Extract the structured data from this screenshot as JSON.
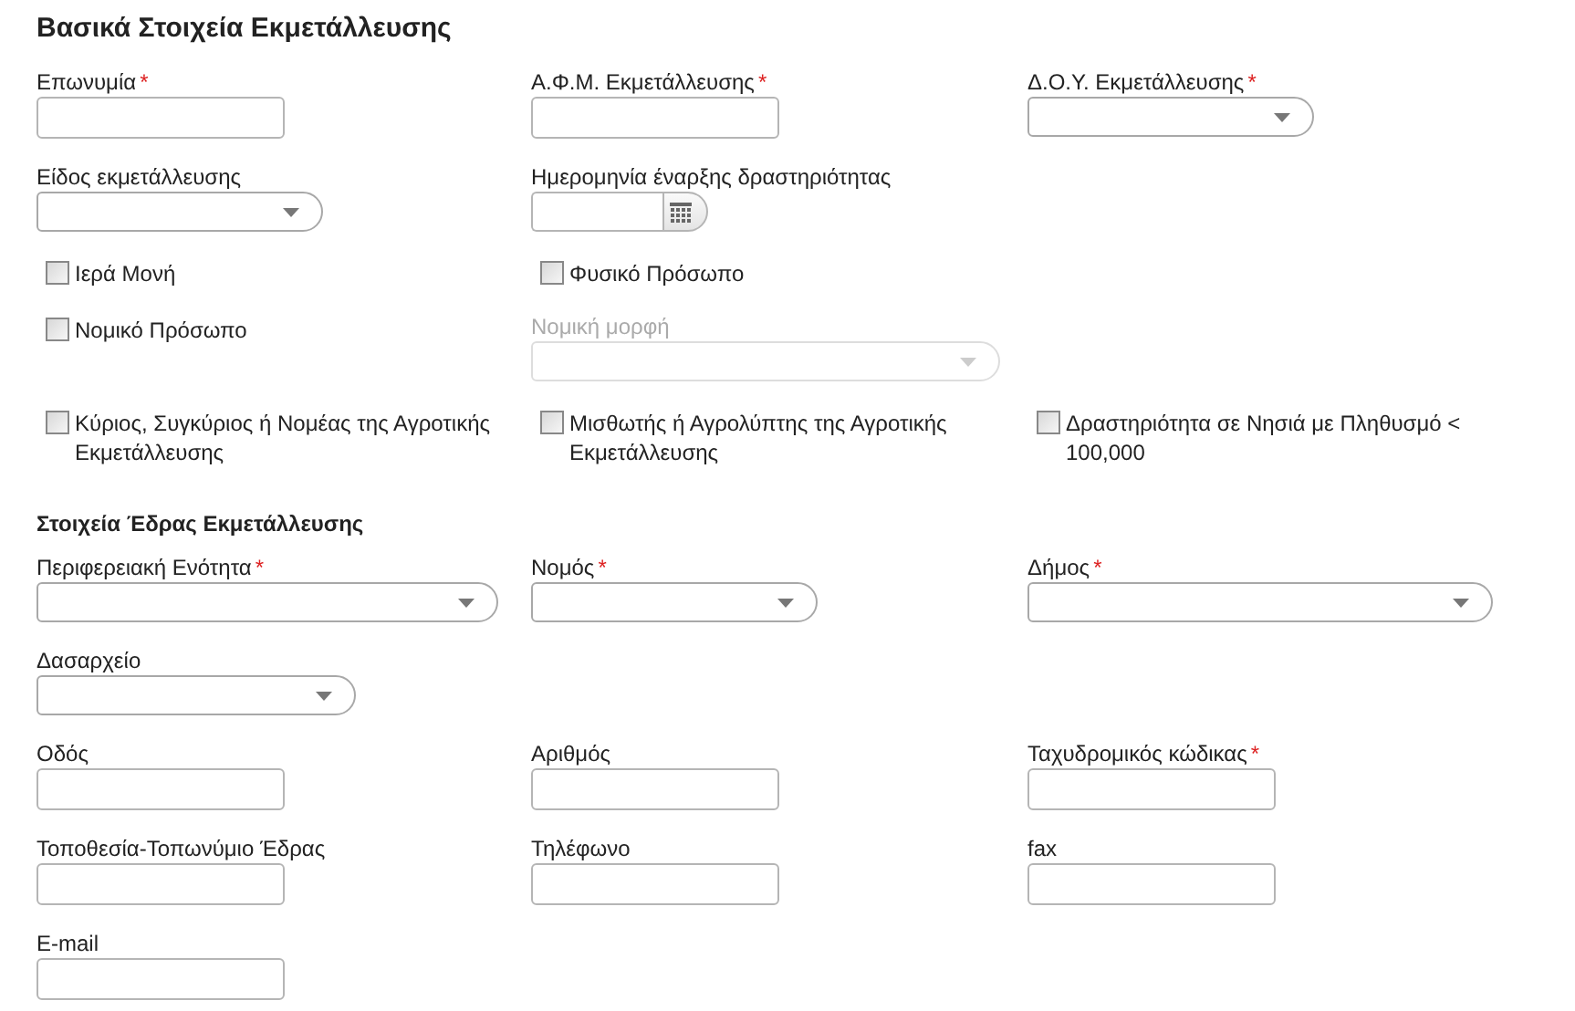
{
  "sections": [
    {
      "kind": "heading",
      "title": "Βασικά Στοιχεία Εκμετάλλευσης",
      "rows": [
        [
          {
            "kind": "input",
            "label": "Επωνυμία",
            "required_mark": "*"
          },
          {
            "kind": "input",
            "label": "Α.Φ.Μ. Εκμετάλλευσης",
            "required_mark": "*"
          },
          {
            "kind": "select",
            "label": "Δ.Ο.Υ. Εκμετάλλευσης",
            "required_mark": "*",
            "disabled": false
          }
        ],
        [
          {
            "kind": "select",
            "label": "Είδος εκμετάλλευσης",
            "disabled": false
          },
          {
            "kind": "date",
            "label": "Ημερομηνία έναρξης δραστηριότητας"
          },
          null
        ],
        [
          {
            "kind": "checkbox",
            "label": "Ιερά Μονή",
            "checked": false
          },
          {
            "kind": "checkbox",
            "label": "Φυσικό Πρόσωπο",
            "checked": false
          },
          null
        ],
        [
          {
            "kind": "checkbox",
            "label": "Νομικό Πρόσωπο",
            "checked": false
          },
          {
            "kind": "select",
            "label": "Νομική μορφή",
            "disabled": true
          },
          null
        ],
        [
          {
            "kind": "checkbox",
            "label": "Κύριος, Συγκύριος ή Νομέας της Αγροτικής Εκμετάλλευσης",
            "checked": false
          },
          {
            "kind": "checkbox",
            "label": "Μισθωτής ή Αγρολύπτης της Αγροτικής Εκμετάλλευσης",
            "checked": false
          },
          {
            "kind": "checkbox",
            "label": "Δραστηριότητα σε Νησιά με Πληθυσμό < 100,000",
            "checked": false
          }
        ]
      ]
    },
    {
      "kind": "subheading",
      "title": "Στοιχεία Έδρας Εκμετάλλευσης",
      "rows": [
        [
          {
            "kind": "select",
            "label": "Περιφερειακή Ενότητα",
            "required_mark": "*",
            "disabled": false
          },
          {
            "kind": "select",
            "label": "Νομός",
            "required_mark": "*",
            "disabled": false
          },
          {
            "kind": "select",
            "label": "Δήμος",
            "required_mark": "*",
            "disabled": false
          }
        ],
        [
          {
            "kind": "select",
            "label": "Δασαρχείο",
            "disabled": false
          },
          null,
          null
        ],
        [
          {
            "kind": "input",
            "label": "Οδός"
          },
          {
            "kind": "input",
            "label": "Αριθμός"
          },
          {
            "kind": "input",
            "label": "Ταχυδρομικός κώδικας",
            "required_mark": "*"
          }
        ],
        [
          {
            "kind": "input",
            "label": "Τοποθεσία-Τοπωνύμιο Έδρας"
          },
          {
            "kind": "input",
            "label": "Τηλέφωνο"
          },
          {
            "kind": "input",
            "label": "fax"
          }
        ],
        [
          {
            "kind": "input",
            "label": "E-mail"
          },
          null,
          null
        ]
      ]
    }
  ]
}
